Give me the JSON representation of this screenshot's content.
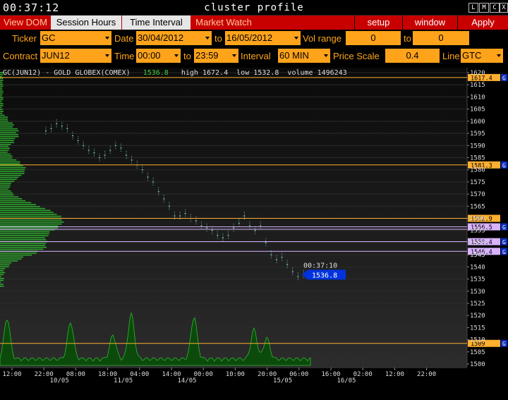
{
  "titlebar": {
    "clock": "00:37:12",
    "title": "cluster profile",
    "buttons": [
      "L",
      "M",
      "C",
      "X"
    ]
  },
  "menu": {
    "view_dom": "View DOM",
    "session_hours": "Session Hours",
    "time_interval": "Time Interval",
    "market_watch": "Market Watch",
    "setup": "setup",
    "window": "window",
    "apply": "Apply"
  },
  "controls": {
    "ticker_label": "Ticker",
    "ticker": "GC",
    "date_label": "Date",
    "date_from": "30/04/2012",
    "to_label": "to",
    "date_to": "16/05/2012",
    "vol_range_label": "Vol range",
    "vol_min": "0",
    "vol_max": "0",
    "contract_label": "Contract",
    "contract": "JUN12",
    "time_label": "Time",
    "time_from": "00:00",
    "time_to": "23:59",
    "interval_label": "Interval",
    "interval": "60 MIN",
    "price_scale_label": "Price Scale",
    "price_scale": "0.4",
    "line_label": "Line",
    "line": "GTC"
  },
  "info": {
    "symbol": "GC(JUN12) - GOLD GLOBEX(COMEX)",
    "last": "1536.8",
    "high": "high 1672.4",
    "low": "low 1532.8",
    "volume": "volume 1496243"
  },
  "chart_data": {
    "type": "line",
    "y_axis_ticks": [
      1620,
      1615,
      1610,
      1605,
      1600,
      1595,
      1590,
      1585,
      1580,
      1575,
      1570,
      1565,
      1560,
      1555,
      1550,
      1545,
      1540,
      1535,
      1530,
      1525,
      1520,
      1515,
      1510,
      1505,
      1500
    ],
    "ylim": [
      1498,
      1621
    ],
    "x_axis_ticks": [
      "12:00",
      "22:00",
      "08:00",
      "18:00",
      "04:00",
      "14:00",
      "00:00",
      "10:00",
      "20:00",
      "06:00",
      "16:00",
      "02:00",
      "12:00",
      "22:00"
    ],
    "x_axis_dates": [
      {
        "label": "10/05",
        "tick": 1
      },
      {
        "label": "11/05",
        "tick": 3
      },
      {
        "label": "14/05",
        "tick": 5
      },
      {
        "label": "15/05",
        "tick": 8
      },
      {
        "label": "16/05",
        "tick": 10
      }
    ],
    "price_series": [
      1596,
      1597,
      1599,
      1598,
      1597,
      1594,
      1592,
      1590,
      1588,
      1587,
      1585,
      1586,
      1588,
      1590,
      1589,
      1586,
      1584,
      1582,
      1580,
      1577,
      1575,
      1571,
      1568,
      1565,
      1561,
      1561,
      1562,
      1560,
      1559,
      1557,
      1556,
      1555,
      1553,
      1552,
      1553,
      1556,
      1558,
      1561,
      1557,
      1555,
      1557,
      1550,
      1545,
      1543,
      1544,
      1541,
      1538,
      1536,
      1537
    ],
    "levels": [
      {
        "price": 1618,
        "label": "1617.4",
        "color": "#ffb030",
        "side": "G"
      },
      {
        "price": 1582,
        "label": "1581.3",
        "color": "#ffb030",
        "side": "G"
      },
      {
        "price": 1560,
        "label": "1562.9",
        "color": "#ffb030",
        "side": ""
      },
      {
        "price": 1556.5,
        "label": "1556.5",
        "color": "#d9b3ff",
        "side": "G"
      },
      {
        "price": 1555.5,
        "label": "",
        "color": "#d9b3ff",
        "side": ""
      },
      {
        "price": 1550.4,
        "label": "1550.4",
        "color": "#d9b3ff",
        "side": "G"
      },
      {
        "price": 1546.4,
        "label": "1546.4",
        "color": "#d9b3ff",
        "side": "G"
      },
      {
        "price": 1508.5,
        "label": "1509",
        "color": "#ffb030",
        "side": "G"
      }
    ],
    "current": {
      "time": "00:37:10",
      "price": "1536.8"
    },
    "volume_profile_description": "horizontal green histogram on left",
    "colors": {
      "bg": "#1a1a1a",
      "grid": "#2a2a2a",
      "accent": "#ffa31a",
      "menu": "#c80000",
      "up": "#3fd13f",
      "price_tag": "#0033dd"
    }
  }
}
